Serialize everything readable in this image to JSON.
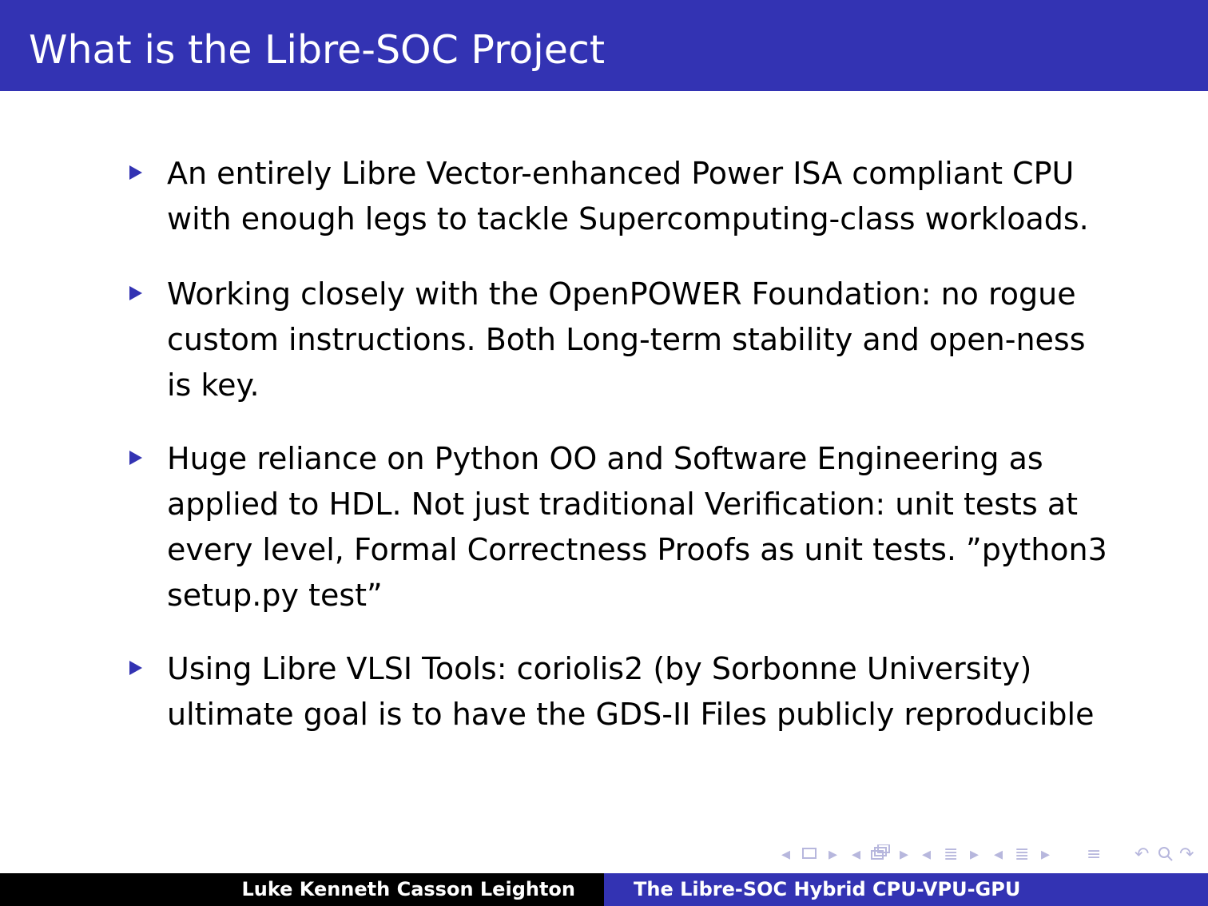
{
  "slide": {
    "title": "What is the Libre-SOC Project",
    "bullets": [
      {
        "text": "An entirely Libre Vector-enhanced Power ISA compliant CPU\nwith enough legs to tackle Supercomputing-class workloads."
      },
      {
        "text": "Working closely with the OpenPOWER Foundation: no rogue\ncustom instructions. Both Long-term stability and open-ness\nis key."
      },
      {
        "text": "Huge reliance on Python OO and Software Engineering as\napplied to HDL. Not just traditional Verification: unit tests at\nevery level, Formal Correctness Proofs as unit tests. ”python3\nsetup.py test”"
      },
      {
        "text": "Using Libre VLSI Tools: coriolis2 (by Sorbonne University)\nultimate goal is to have the GDS-II Files publicly reproducible"
      }
    ]
  },
  "footer": {
    "author": "Luke Kenneth Casson Leighton",
    "talk_title": "The Libre-SOC Hybrid CPU-VPU-GPU"
  },
  "navigation": {
    "icons": [
      "prev-arrow-icon",
      "frame-icon",
      "next-arrow-icon",
      "prev-arrow-icon",
      "subsection-icon",
      "next-arrow-icon",
      "prev-arrow-icon",
      "section-icon",
      "next-arrow-icon",
      "prev-arrow-icon",
      "align-icon",
      "next-arrow-icon",
      "menu-icon",
      "undo-icon",
      "search-icon",
      "redo-icon"
    ]
  },
  "colors": {
    "accent": "#3333b3",
    "footer_left_bg": "#000000",
    "title_text": "#ffffff",
    "nav_icons": "#b7b7dd"
  }
}
